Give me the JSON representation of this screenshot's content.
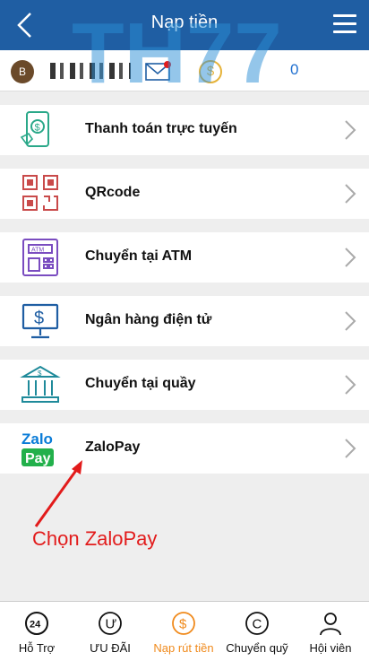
{
  "header": {
    "title": "Nạp tiền"
  },
  "user": {
    "avatar_letter": "B",
    "balance": "0"
  },
  "watermark": {
    "text": "TH77"
  },
  "menu_items": [
    {
      "label": "Thanh toán trực tuyến",
      "icon": "mobile-payment-icon"
    },
    {
      "label": "QRcode",
      "icon": "qrcode-icon"
    },
    {
      "label": "Chuyển tại ATM",
      "icon": "atm-icon"
    },
    {
      "label": "Ngân hàng điện tử",
      "icon": "online-banking-icon"
    },
    {
      "label": "Chuyển tại quầy",
      "icon": "bank-counter-icon"
    },
    {
      "label": "ZaloPay",
      "icon": "zalopay-icon",
      "logo_top": "Zalo",
      "logo_bottom": "Pay"
    }
  ],
  "annotation": {
    "text": "Chọn ZaloPay"
  },
  "tabs": [
    {
      "label": "Hỗ Trợ",
      "icon": "support-24-icon",
      "glyph": "24"
    },
    {
      "label": "ƯU ĐÃI",
      "icon": "promotion-icon",
      "glyph": "Ư"
    },
    {
      "label": "Nạp rút tiền",
      "icon": "deposit-withdraw-icon",
      "glyph": "$",
      "active": true
    },
    {
      "label": "Chuyển quỹ",
      "icon": "fund-transfer-icon",
      "glyph": "C"
    },
    {
      "label": "Hội viên",
      "icon": "member-icon"
    }
  ],
  "colors": {
    "header": "#1f5ea3",
    "accent": "#f08a1c",
    "annotation": "#e21b1b",
    "balance": "#1f6fd0"
  }
}
